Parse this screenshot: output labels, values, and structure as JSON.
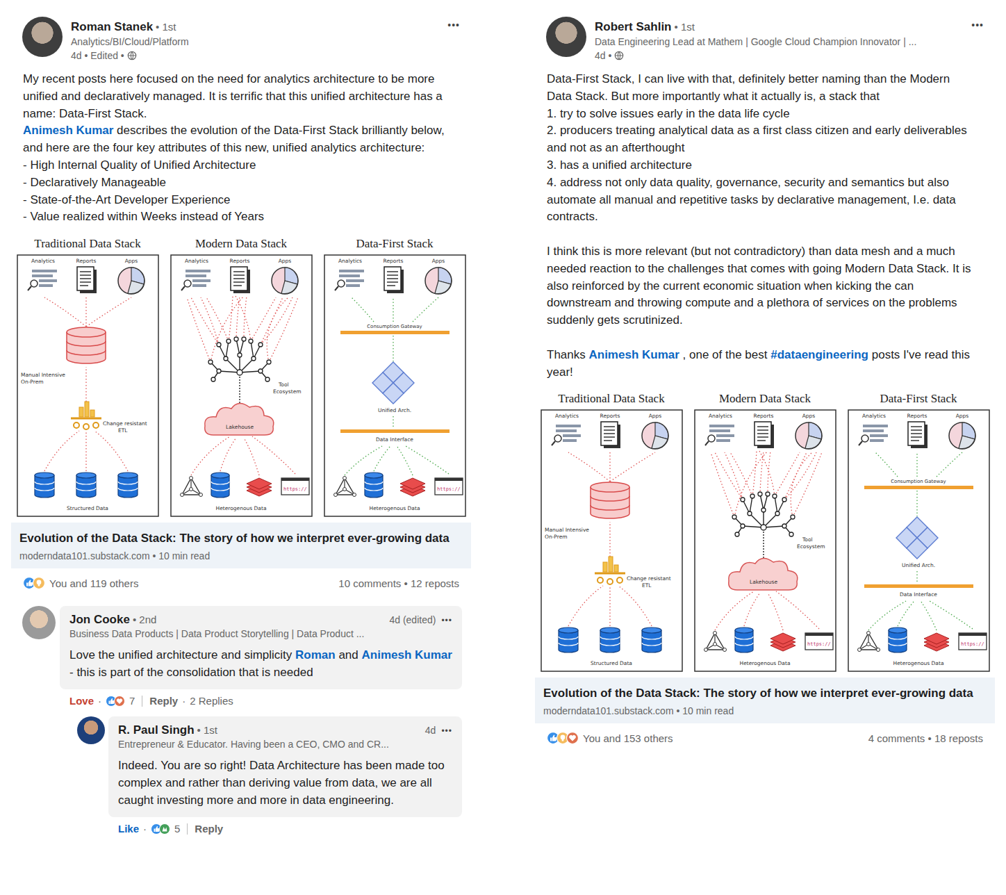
{
  "posts": [
    {
      "author": {
        "name": "Roman Stanek",
        "degree": "• 1st",
        "headline": "Analytics/BI/Cloud/Platform",
        "meta": "4d • Edited •"
      },
      "menu": "•••",
      "body": [
        [
          {
            "text": "My recent posts here focused on the need for analytics architecture to be more unified and declaratively managed. It is terrific that this unified architecture has a name: Data-First Stack.",
            "link": false
          }
        ],
        [
          {
            "text": "Animesh Kumar",
            "link": true
          },
          {
            "text": " describes the evolution of the Data-First Stack brilliantly below, and here are the four key attributes of this new, unified analytics architecture:",
            "link": false
          }
        ],
        [
          {
            "text": "- High Internal Quality of Unified Architecture",
            "link": false
          }
        ],
        [
          {
            "text": "- Declaratively Manageable",
            "link": false
          }
        ],
        [
          {
            "text": "- State-of-the-Art Developer Experience",
            "link": false
          }
        ],
        [
          {
            "text": "- Value realized within Weeks instead of Years",
            "link": false
          }
        ]
      ],
      "image": {
        "panels": [
          {
            "kind": "traditional",
            "title": "Traditional Data Stack",
            "top_labels": [
              "Analytics",
              "Reports",
              "Apps"
            ],
            "notes": [
              [
                "Manual Intensive",
                "On-Prem"
              ],
              [
                "Change resistant",
                "ETL"
              ]
            ],
            "bottom": "Structured Data"
          },
          {
            "kind": "modern",
            "title": "Modern Data Stack",
            "top_labels": [
              "Analytics",
              "Reports",
              "Apps"
            ],
            "notes": [
              [
                "Tool",
                "Ecosystem"
              ],
              [
                "Lakehouse"
              ]
            ],
            "link_text": "https://",
            "bottom": "Heterogenous Data"
          },
          {
            "kind": "data-first",
            "title": "Data-First Stack",
            "top_labels": [
              "Analytics",
              "Reports",
              "Apps"
            ],
            "notes": [
              [
                "Consumption Gateway"
              ],
              [
                "Unified Arch."
              ],
              [
                "Data Interface"
              ]
            ],
            "link_text": "https://",
            "bottom": "Heterogenous Data"
          }
        ]
      },
      "link_card": {
        "title": "Evolution of the Data Stack: The story of how we interpret ever-growing data",
        "source": "moderndata101.substack.com • 10 min read"
      },
      "social": {
        "reactions": [
          {
            "kind": "like"
          },
          {
            "kind": "insightful"
          }
        ],
        "summary": "You and 119 others",
        "stats": "10 comments • 12 reposts"
      },
      "comments": [
        {
          "author": {
            "name": "Jon Cooke",
            "degree": "• 2nd",
            "headline": "Business Data Products | Data Product Storytelling | Data Product ..."
          },
          "time": "4d (edited)",
          "menu": "•••",
          "body": [
            {
              "text": "Love the unified architecture and simplicity ",
              "link": false
            },
            {
              "text": "Roman",
              "link": true
            },
            {
              "text": " and ",
              "link": false
            },
            {
              "text": "Animesh Kumar",
              "link": true
            },
            {
              "text": " - this is part of the consolidation that is needed",
              "link": false
            }
          ],
          "reaction": {
            "label": "Love",
            "active": true,
            "color": "#c4402f"
          },
          "separator": "·",
          "reactions": [
            {
              "kind": "like"
            },
            {
              "kind": "love"
            }
          ],
          "count": "7",
          "reply": "Reply",
          "replies_label": "2 Replies",
          "replies": [
            {
              "author": {
                "name": "R. Paul Singh",
                "degree": "• 1st",
                "headline": "Entrepreneur & Educator. Having been a CEO, CMO and CR..."
              },
              "time": "4d",
              "menu": "•••",
              "body": [
                {
                  "text": "Indeed. You are so right! Data Architecture has been made too complex and rather than deriving value from data, we are all caught investing more and more in data engineering.",
                  "link": false
                }
              ],
              "reaction": {
                "label": "Like",
                "active": true,
                "color": "#0a66c2"
              },
              "separator": "·",
              "reactions": [
                {
                  "kind": "like"
                },
                {
                  "kind": "celebrate"
                }
              ],
              "count": "5",
              "reply": "Reply"
            }
          ]
        }
      ]
    },
    {
      "author": {
        "name": "Robert Sahlin",
        "degree": "• 1st",
        "headline": "Data Engineering Lead at Mathem | Google Cloud Champion Innovator | ...",
        "meta": "4d •"
      },
      "menu": "•••",
      "body": [
        [
          {
            "text": "Data-First Stack, I can live with that, definitely better naming than the Modern Data Stack. But more importantly what it actually is, a stack that",
            "link": false
          }
        ],
        [
          {
            "text": "1. try to solve issues early in the data life cycle",
            "link": false
          }
        ],
        [
          {
            "text": "2. producers treating analytical data as a first class citizen and early deliverables and not as an afterthought",
            "link": false
          }
        ],
        [
          {
            "text": "3. has a unified architecture",
            "link": false
          }
        ],
        [
          {
            "text": "4. address not only data quality, governance, security and semantics but also automate all manual and repetitive tasks by declarative management, I.e. data contracts.",
            "link": false
          }
        ],
        [],
        [
          {
            "text": "I think this is more relevant (but not contradictory) than data mesh and a much needed reaction to the challenges that comes with going Modern Data Stack. It is also reinforced by the current economic situation when kicking the can downstream and throwing compute and a plethora of services on the problems suddenly gets scrutinized.",
            "link": false
          }
        ],
        [],
        [
          {
            "text": "Thanks ",
            "link": false
          },
          {
            "text": "Animesh Kumar",
            "link": true
          },
          {
            "text": " , one of the best ",
            "link": false
          },
          {
            "text": "#dataengineering",
            "link": true
          },
          {
            "text": " posts I've read this year!",
            "link": false
          }
        ]
      ],
      "image": {
        "panels": [
          {
            "kind": "traditional",
            "title": "Traditional Data Stack",
            "top_labels": [
              "Analytics",
              "Reports",
              "Apps"
            ],
            "notes": [
              [
                "Manual Intensive",
                "On-Prem"
              ],
              [
                "Change resistant",
                "ETL"
              ]
            ],
            "bottom": "Structured Data"
          },
          {
            "kind": "modern",
            "title": "Modern Data Stack",
            "top_labels": [
              "Analytics",
              "Reports",
              "Apps"
            ],
            "notes": [
              [
                "Tool",
                "Ecosystem"
              ],
              [
                "Lakehouse"
              ]
            ],
            "link_text": "https://",
            "bottom": "Heterogenous Data"
          },
          {
            "kind": "data-first",
            "title": "Data-First Stack",
            "top_labels": [
              "Analytics",
              "Reports",
              "Apps"
            ],
            "notes": [
              [
                "Consumption Gateway"
              ],
              [
                "Unified Arch."
              ],
              [
                "Data Interface"
              ]
            ],
            "link_text": "https://",
            "bottom": "Heterogenous Data"
          }
        ]
      },
      "link_card": {
        "title": "Evolution of the Data Stack: The story of how we interpret ever-growing data",
        "source": "moderndata101.substack.com • 10 min read"
      },
      "social": {
        "reactions": [
          {
            "kind": "like"
          },
          {
            "kind": "insightful"
          },
          {
            "kind": "love"
          }
        ],
        "summary": "You and 153 others",
        "stats": "4 comments • 18 reposts"
      },
      "comments": []
    }
  ]
}
